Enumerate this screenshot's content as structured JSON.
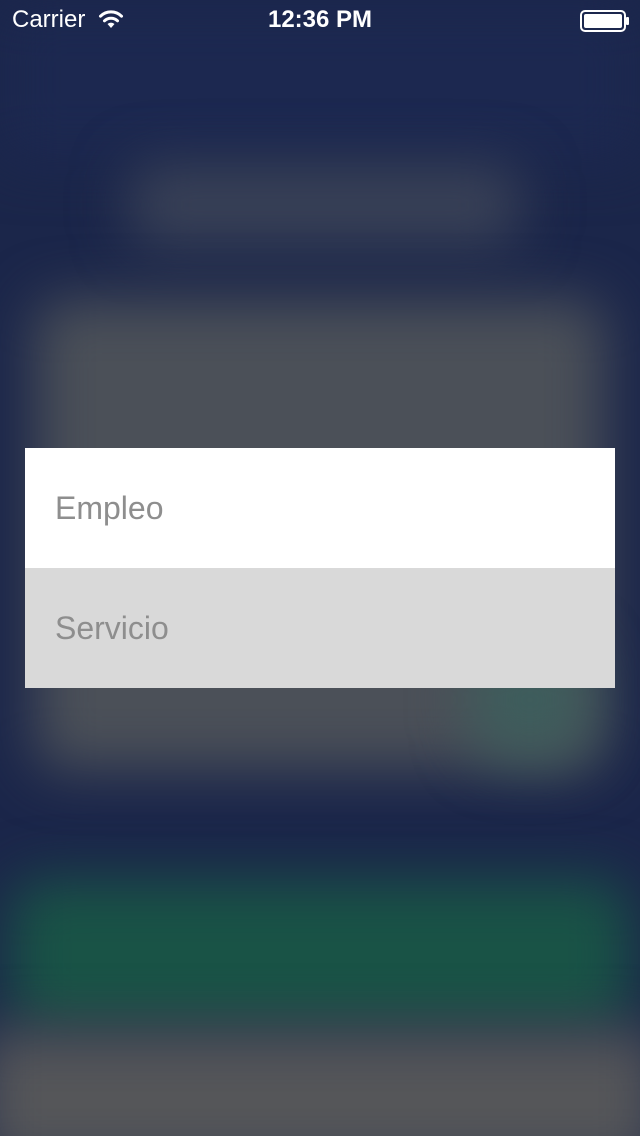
{
  "status_bar": {
    "carrier": "Carrier",
    "time": "12:36 PM",
    "wifi_icon": "wifi-icon",
    "battery_icon": "battery-icon"
  },
  "menu": {
    "items": [
      {
        "label": "Empleo",
        "selected": false
      },
      {
        "label": "Servicio",
        "selected": true
      }
    ]
  },
  "colors": {
    "background": "#1b264a",
    "menu_item_bg": "#ffffff",
    "menu_item_highlight_bg": "#d9d9d9",
    "menu_text": "#8e8e8e"
  }
}
